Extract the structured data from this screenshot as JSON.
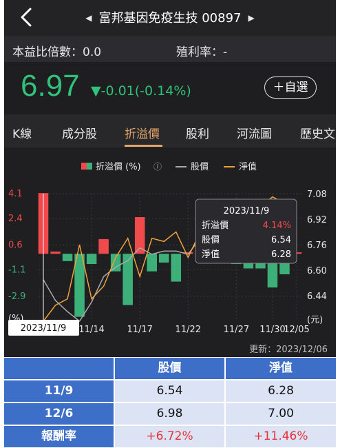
{
  "header": {
    "title": "富邦基因免疫生技 00897",
    "prev_arrow": "◀",
    "next_arrow": "▶"
  },
  "metrics": {
    "pe": "本益比倍數：0.0",
    "yield": "殖利率：-"
  },
  "quote": {
    "price": "6.97",
    "change": "▼-0.01(-0.14%)",
    "watch_label": "＋自選"
  },
  "tabs": [
    "K線",
    "成分股",
    "折溢價",
    "股利",
    "河流圖",
    "歷史文"
  ],
  "active_tab": "折溢價",
  "legend": {
    "premium": "折溢價 (%)",
    "info": "ⓘ",
    "price": "股價",
    "nav": "淨值"
  },
  "colors": {
    "positive": "#f04a4d",
    "negative": "#3db07a",
    "price_line": "#aaaaaa",
    "nav_line": "#f2a03a",
    "header_blue": "#3e6fc8"
  },
  "tooltip": {
    "date": "2023/11/9",
    "premium_label": "折溢價",
    "premium_value": "4.14%",
    "price_label": "股價",
    "price_value": "6.54",
    "nav_label": "淨值",
    "nav_value": "6.28"
  },
  "crosshair_date": "2023/11/9",
  "updated": "更新：2023/12/06",
  "chart_data": {
    "type": "bar",
    "left_axis_label": "(%)",
    "right_axis_label": "(元)",
    "left_ticks": [
      "4.1",
      "2.4",
      "0.6",
      "-1.1",
      "-2.9"
    ],
    "right_ticks": [
      "7.08",
      "6.92",
      "6.76",
      "6.60",
      "6.44"
    ],
    "x_ticks": [
      "11/14",
      "11/17",
      "11/22",
      "11/27",
      "11/30",
      "12/05"
    ],
    "ylim_percent": [
      -4.6,
      4.1
    ],
    "ylim_price": [
      6.28,
      7.08
    ],
    "premium_series": {
      "name": "折溢價 (%)",
      "values": [
        4.14,
        0.15,
        -0.5,
        -4.3,
        -0.7,
        1.0,
        -1.2,
        -3.5,
        2.5,
        -1.2,
        -0.6,
        -1.9,
        0.1,
        -0.4,
        -0.3,
        -0.6,
        -0.7,
        -1.0,
        -1.0,
        -2.3,
        -1.4,
        0.1
      ]
    },
    "price_series": {
      "name": "股價",
      "values": [
        6.54,
        6.41,
        6.34,
        6.28,
        6.4,
        6.56,
        6.62,
        6.66,
        6.74,
        6.7,
        6.72,
        6.72,
        6.7,
        6.8,
        6.8,
        6.84,
        6.84,
        6.9,
        6.93,
        6.96,
        7.0,
        6.98
      ]
    },
    "nav_series": {
      "name": "淨值",
      "values": [
        6.28,
        6.38,
        6.42,
        6.76,
        6.42,
        6.5,
        6.68,
        6.8,
        6.56,
        6.8,
        6.78,
        6.84,
        6.68,
        6.84,
        6.84,
        6.9,
        6.88,
        6.96,
        7.0,
        7.06,
        7.02,
        7.0
      ]
    }
  },
  "table": {
    "headers": [
      "",
      "股價",
      "淨值"
    ],
    "rows": [
      {
        "label": "11/9",
        "price": "6.54",
        "nav": "6.28"
      },
      {
        "label": "12/6",
        "price": "6.98",
        "nav": "7.00"
      },
      {
        "label": "報酬率",
        "price": "+6.72%",
        "nav": "+11.46%"
      }
    ]
  }
}
